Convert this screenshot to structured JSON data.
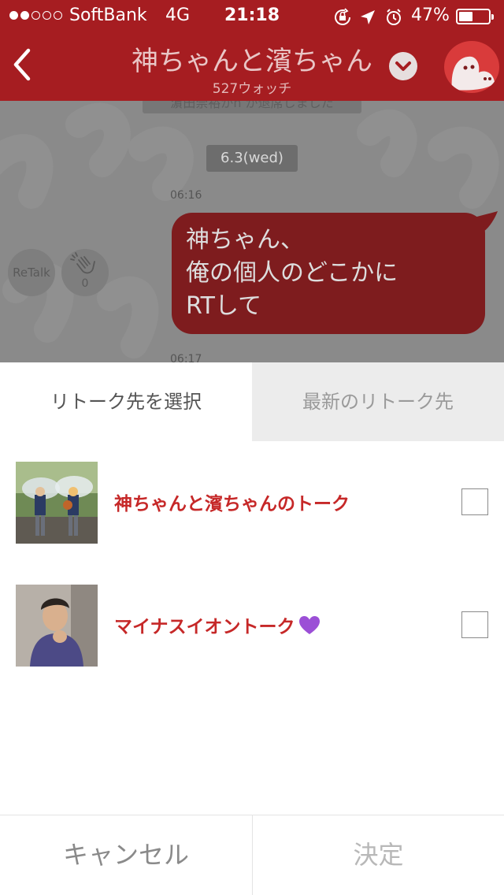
{
  "status_bar": {
    "carrier": "SoftBank",
    "network": "4G",
    "time": "21:18",
    "battery_percent": "47%",
    "battery_level": 0.47,
    "signal_bars": 2,
    "icons": [
      "rotation-lock-icon",
      "location-arrow-icon",
      "alarm-icon"
    ]
  },
  "header": {
    "title": "神ちゃんと濱ちゃん",
    "subtitle": "527ウォッチ",
    "back_icon": "chevron-left-icon",
    "dropdown_icon": "chevron-down-icon",
    "avatar_icon": "ghost-mascot-icon"
  },
  "chat": {
    "system_message": "濵田崇裕がn が退席しました",
    "date_label": "6.3(wed)",
    "message_time": "06:16",
    "next_message_time": "06:17",
    "message_lines": [
      "神ちゃん、",
      "俺の個人のどこかに",
      "RTして"
    ],
    "retalk_label": "ReTalk",
    "clap_count": "0"
  },
  "sheet": {
    "tabs": [
      {
        "label": "リトーク先を選択",
        "active": true
      },
      {
        "label": "最新のリトーク先",
        "active": false
      }
    ],
    "destinations": [
      {
        "label": "神ちゃんと濱ちゃんのトーク",
        "checked": false,
        "thumbnail": "two-people-with-umbrellas-photo"
      },
      {
        "label": "マイナスイオントーク",
        "emoji": "purple-heart-icon",
        "checked": false,
        "thumbnail": "man-in-purple-sweater-photo"
      }
    ],
    "cancel_label": "キャンセル",
    "confirm_label": "決定"
  },
  "colors": {
    "brand_red": "#a61d21",
    "label_red": "#c62828",
    "heart_purple": "#9b4fd6"
  }
}
